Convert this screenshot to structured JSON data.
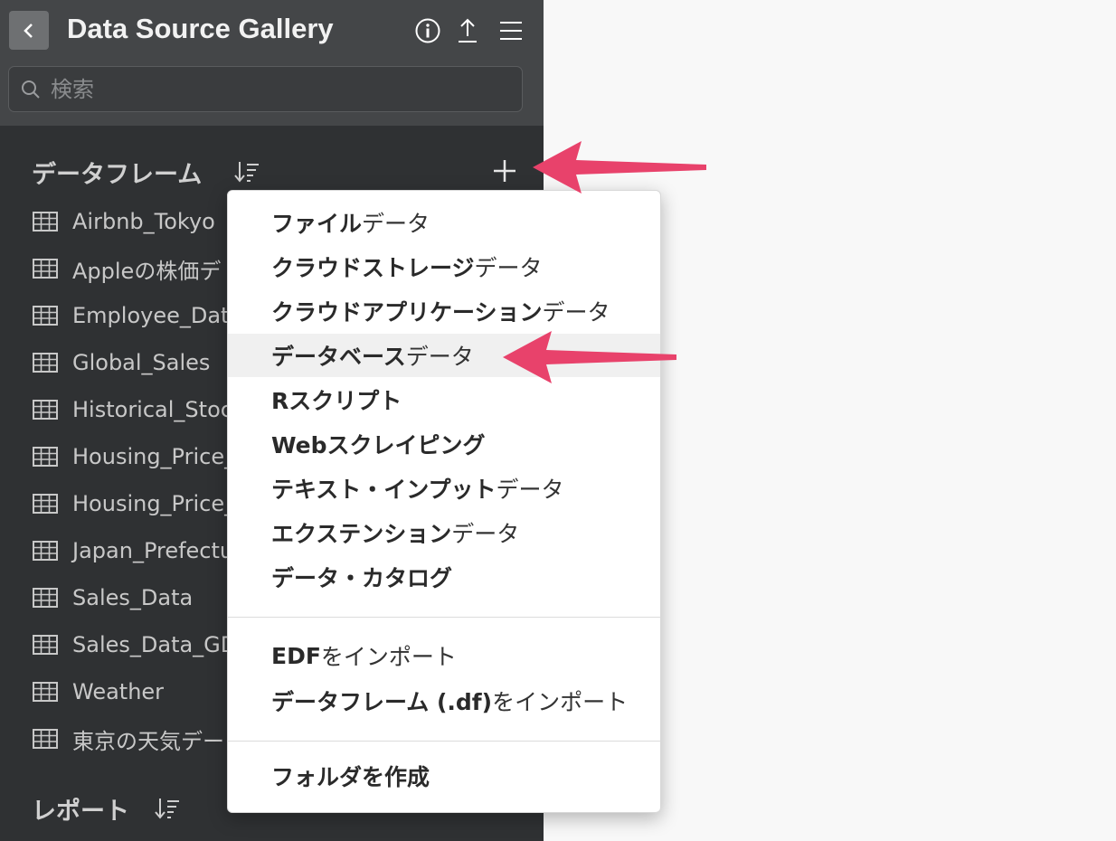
{
  "header": {
    "title": "Data Source Gallery"
  },
  "search": {
    "placeholder": "検索"
  },
  "dataframes": {
    "heading": "データフレーム",
    "items": [
      "Airbnb_Tokyo",
      "Appleの株価デ",
      "Employee_Data",
      "Global_Sales",
      "Historical_Stoc",
      "Housing_Price_",
      "Housing_Price_",
      "Japan_Prefectu",
      "Sales_Data",
      "Sales_Data_GD",
      "Weather",
      "東京の天気デー"
    ]
  },
  "reports": {
    "heading": "レポート"
  },
  "menu": {
    "items": [
      {
        "bold": "ファイル",
        "normal": "データ"
      },
      {
        "bold": "クラウドストレージ",
        "normal": "データ"
      },
      {
        "bold": "クラウドアプリケーション",
        "normal": "データ"
      },
      {
        "bold": "データベース",
        "normal": "データ"
      },
      {
        "bold": "Rスクリプト",
        "normal": ""
      },
      {
        "bold": "Webスクレイピング",
        "normal": ""
      },
      {
        "bold": "テキスト・インプット",
        "normal": "データ"
      },
      {
        "bold": "エクステンション",
        "normal": "データ"
      },
      {
        "bold": "データ・カタログ",
        "normal": ""
      },
      {
        "bold": "EDF",
        "normal": "をインポート"
      },
      {
        "bold": "データフレーム (.df)",
        "normal": "をインポート"
      },
      {
        "bold": "フォルダを作成",
        "normal": ""
      }
    ]
  },
  "colors": {
    "sidebar": "#2f3133",
    "topbar": "#444648",
    "arrow": "#e8426b",
    "highlight": "#f0f0f0"
  },
  "icons": [
    "back-icon",
    "info-icon",
    "upload-icon",
    "menu-icon",
    "search-icon",
    "sort-icon",
    "plus-icon",
    "table-icon"
  ]
}
